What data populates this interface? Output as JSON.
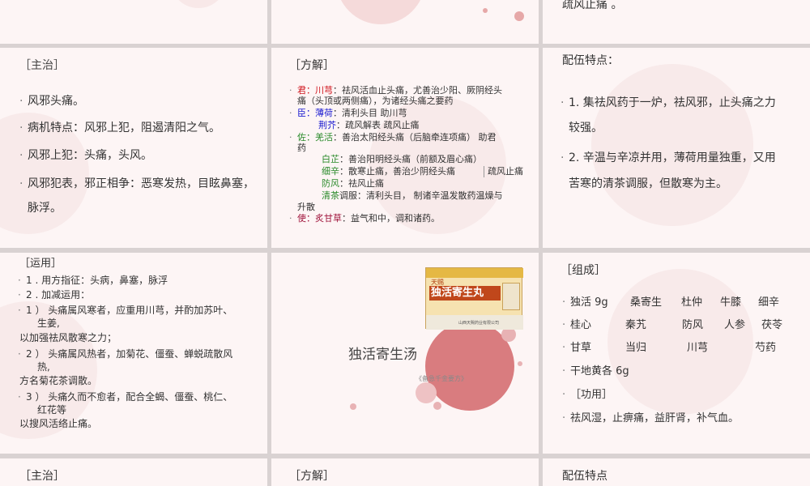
{
  "top": {
    "right_tail": "疏风止痛 。"
  },
  "s1": {
    "heading": "［主治］",
    "lines": [
      "风邪头痛。",
      "病机特点：风邪上犯，阻遏清阳之气。",
      "风邪上犯：头痛，头风。",
      "风邪犯表，邪正相争：恶寒发热，目眩鼻塞，",
      "脉浮。"
    ]
  },
  "s2": {
    "heading": "［方解］",
    "jun_tag": "君：",
    "jun_herb": "川芎",
    "jun_desc": "：祛风活血止头痛，尤善治少阳、厥阴经头",
    "jun_desc2": "痛（头顶或两侧痛），为诸经头痛之要药",
    "chen_tag": "臣：",
    "chen_herb": "薄荷",
    "chen_desc": "：清利头目    助川芎",
    "jingjie_herb": "荆芥",
    "jingjie_desc": "：疏风解表    疏风止痛",
    "zuo_tag": "佐：",
    "zuo_herb": "羌活",
    "zuo_desc": "：善治太阳经头痛（后脑牵连项痛）    助君",
    "zuo_desc2": "药",
    "baizhi_herb": "白芷",
    "baizhi_desc": "：善治阳明经头痛（前额及眉心痛）",
    "xixin_herb": "细辛",
    "xixin_desc": "：散寒止痛，善治少阴经头痛",
    "xixin_side": "疏风止痛",
    "fangfeng_herb": "防风",
    "fangfeng_desc": "：祛风止痛",
    "qingcha_herb": "清茶",
    "qingcha_desc": "调服：清利头目，  制诸辛温发散药温燥与",
    "qingcha_desc2": "升散",
    "shi_tag": "使：",
    "shi_herb": "炙甘草",
    "shi_desc": "：益气和中，调和诸药。"
  },
  "s3": {
    "heading": "配伍特点：",
    "lines": [
      "1. 集祛风药于一炉，祛风邪，止头痛之力",
      "较强。",
      "2. 辛温与辛凉并用，薄荷用量独重，又用",
      "苦寒的清茶调服，但散寒为主。"
    ]
  },
  "s4": {
    "heading": "［运用］",
    "lines": [
      "1 .  用方指征：头病，鼻塞，脉浮",
      "2 .  加减运用：",
      "1 ）  头痛属风寒者，应重用川芎，并酌加苏叶、",
      "生姜,",
      "以加强祛风散寒之力；",
      "2 ）  头痛属风热者，加菊花、僵蚕、蝉蜕疏散风",
      "热,",
      "方名菊花茶调散。",
      "3 ）  头痛久而不愈者，配合全蝎、僵蚕、桃仁、",
      "红花等",
      "以搜风活络止痛。"
    ]
  },
  "s5": {
    "title": "独活寄生汤",
    "subtitle": "《备急千金要方》",
    "box_brand": "天赐",
    "box_name": "独活寄生丸",
    "box_maker": "山西天赐药业有限公司"
  },
  "s6": {
    "heading": "［组成］",
    "row1": [
      "独活 9g",
      "桑寄生",
      "杜仲",
      "牛膝",
      "细辛"
    ],
    "row2": [
      "桂心",
      "秦艽",
      "防风",
      "人参",
      "茯苓"
    ],
    "row3": [
      "甘草",
      "当归",
      "川芎",
      "芍药"
    ],
    "row4": "干地黄各 6g",
    "gongyong": "［功用］",
    "gongyong_text": "祛风湿，止痹痛，益肝肾，补气血。"
  },
  "bottom": {
    "h1": "［主治］",
    "h2": "［方解］",
    "h3": "配伍特点"
  }
}
